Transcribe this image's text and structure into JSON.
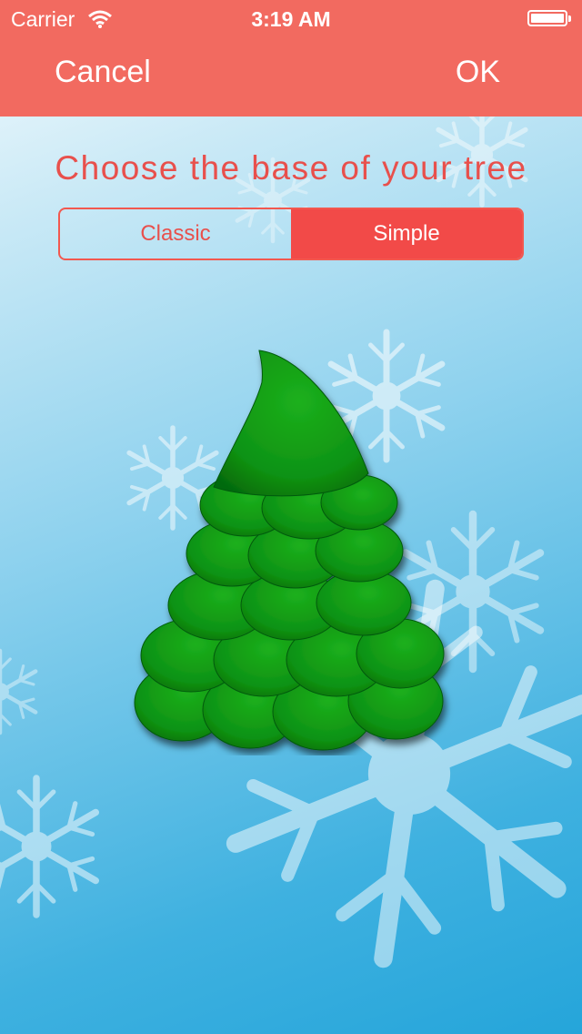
{
  "status_bar": {
    "carrier": "Carrier",
    "time": "3:19 AM"
  },
  "nav": {
    "cancel_label": "Cancel",
    "ok_label": "OK"
  },
  "prompt": "Choose the base of your tree",
  "segments": {
    "options": [
      "Classic",
      "Simple"
    ],
    "selected": "Simple"
  },
  "colors": {
    "header": "#f26a60",
    "accent": "#f24a48",
    "tree_green": "#12a012"
  }
}
